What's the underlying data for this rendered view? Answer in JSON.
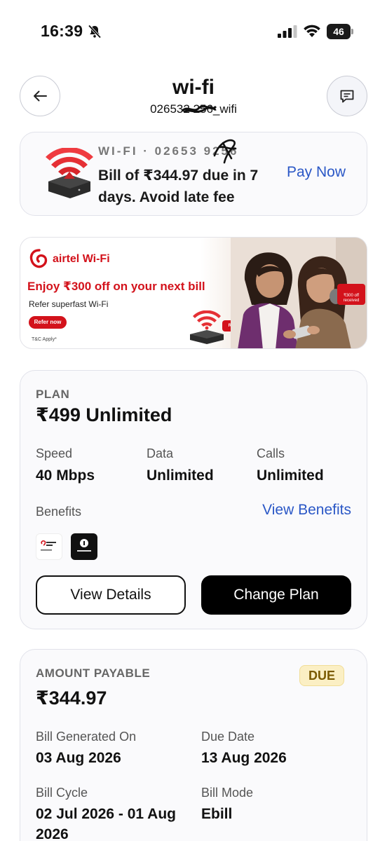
{
  "status_bar": {
    "time": "16:39",
    "battery": "46"
  },
  "header": {
    "title": "wi-fi",
    "account": "026532 256_wifi"
  },
  "bill_card": {
    "label": "WI-FI · 02653 9256",
    "message": "Bill of ₹344.97 due in 7 days. Avoid late fee",
    "pay_now": "Pay Now"
  },
  "banner": {
    "brand": "airtel Wi-Fi",
    "headline": "Enjoy ₹300 off on your next bill",
    "subtext": "Refer superfast Wi-Fi",
    "cta": "Refer now",
    "tc": "T&C Apply*",
    "referred_tag": "Referred!",
    "badge": "₹300 off received"
  },
  "plan": {
    "label": "PLAN",
    "name": "₹499 Unlimited",
    "stats": [
      {
        "label": "Speed",
        "value": "40 Mbps"
      },
      {
        "label": "Data",
        "value": "Unlimited"
      },
      {
        "label": "Calls",
        "value": "Unlimited"
      }
    ],
    "benefits_label": "Benefits",
    "view_benefits": "View Benefits",
    "benefit_apps": [
      "Xstream Play",
      "Google One"
    ],
    "view_details": "View Details",
    "change_plan": "Change Plan"
  },
  "amount": {
    "label": "AMOUNT PAYABLE",
    "status": "DUE",
    "value": "₹344.97",
    "bill_generated_label": "Bill Generated On",
    "bill_generated_value": "03 Aug 2026",
    "due_date_label": "Due Date",
    "due_date_value": "13 Aug 2026",
    "bill_cycle_label": "Bill Cycle",
    "bill_cycle_value": "02 Jul 2026 - 01 Aug 2026",
    "bill_mode_label": "Bill Mode",
    "bill_mode_value": "Ebill"
  },
  "colors": {
    "accent_link": "#2a57c6",
    "airtel_red": "#d3121b",
    "due_badge_bg": "#fbefc4"
  }
}
